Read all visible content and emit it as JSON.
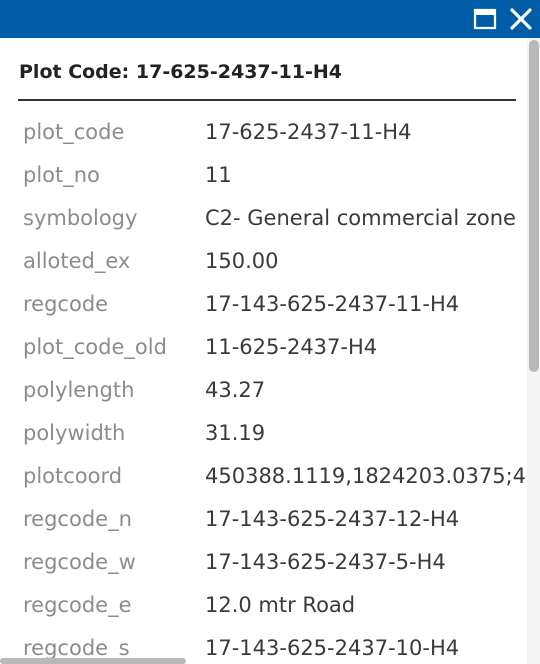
{
  "header": {
    "title": "Plot Code: 17-625-2437-11-H4"
  },
  "attributes": [
    {
      "key": "plot_code",
      "value": "17-625-2437-11-H4"
    },
    {
      "key": "plot_no",
      "value": "11"
    },
    {
      "key": "symbology",
      "value": "C2- General commercial zone"
    },
    {
      "key": "alloted_ex",
      "value": "150.00"
    },
    {
      "key": "regcode",
      "value": "17-143-625-2437-11-H4"
    },
    {
      "key": "plot_code_old",
      "value": "11-625-2437-H4"
    },
    {
      "key": "polylength",
      "value": "43.27"
    },
    {
      "key": "polywidth",
      "value": "31.19"
    },
    {
      "key": "plotcoord",
      "value": "450388.1119,1824203.0375;4"
    },
    {
      "key": "regcode_n",
      "value": "17-143-625-2437-12-H4"
    },
    {
      "key": "regcode_w",
      "value": "17-143-625-2437-5-H4"
    },
    {
      "key": "regcode_e",
      "value": "12.0 mtr Road"
    },
    {
      "key": "regcode_s",
      "value": "17-143-625-2437-10-H4"
    }
  ],
  "icons": {
    "maximize": "maximize-icon",
    "close": "close-icon"
  },
  "colors": {
    "titlebar": "#005ea9",
    "key_text": "#8c8c8c",
    "value_text": "#3a3a3a"
  }
}
